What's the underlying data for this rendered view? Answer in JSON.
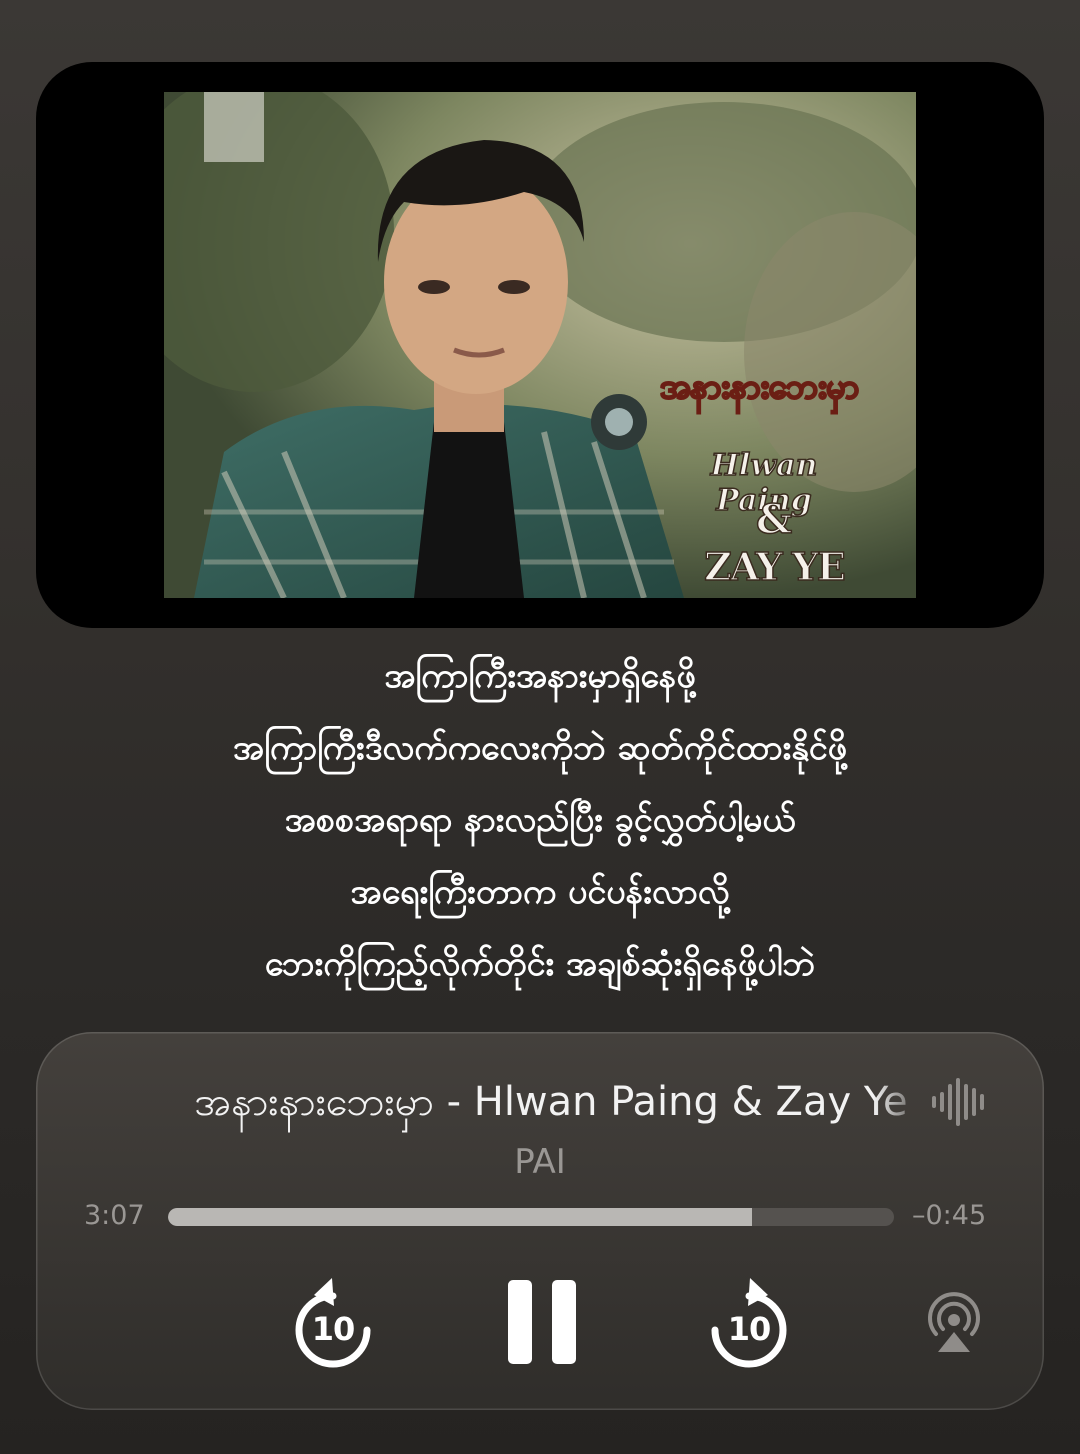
{
  "video": {
    "overlay_title": "အနားနားဘေးမှာ",
    "overlay_artist": "Hlwan Paing",
    "overlay_amp": "&",
    "overlay_artist2": "ZAY YE"
  },
  "lyrics": [
    "အကြာကြီးအနားမှာရှိနေဖို့",
    "အကြာကြီးဒီလက်ကလေးကိုဘဲ ဆုတ်ကိုင်ထားနိုင်ဖို့",
    "အစစအရာရာ နားလည်ပြီး ခွင့်လွှတ်ပါ့မယ်",
    "အရေးကြီးတာက ပင်ပန်းလာလို့",
    "ဘေးကိုကြည့်လိုက်တိုင်း အချစ်ဆုံးရှိနေဖို့ပါဘဲ"
  ],
  "player": {
    "title": "အနားနားဘေးမှာ - Hlwan Paing & Zay Ye",
    "artist": "PAI",
    "elapsed": "3:07",
    "remaining": "–0:45",
    "progress_fraction": 0.805,
    "skip_back_seconds": "10",
    "skip_forward_seconds": "10",
    "icons": {
      "waveform": "waveform-icon",
      "skip_back": "skip-back-10-icon",
      "pause": "pause-icon",
      "skip_forward": "skip-forward-10-icon",
      "airplay": "airplay-audio-icon"
    }
  },
  "colors": {
    "background": "#2f2c29",
    "text_primary": "#ffffff",
    "text_secondary": "#9a9794",
    "progress_fill": "#b9b7b4",
    "progress_track": "#55524f"
  }
}
